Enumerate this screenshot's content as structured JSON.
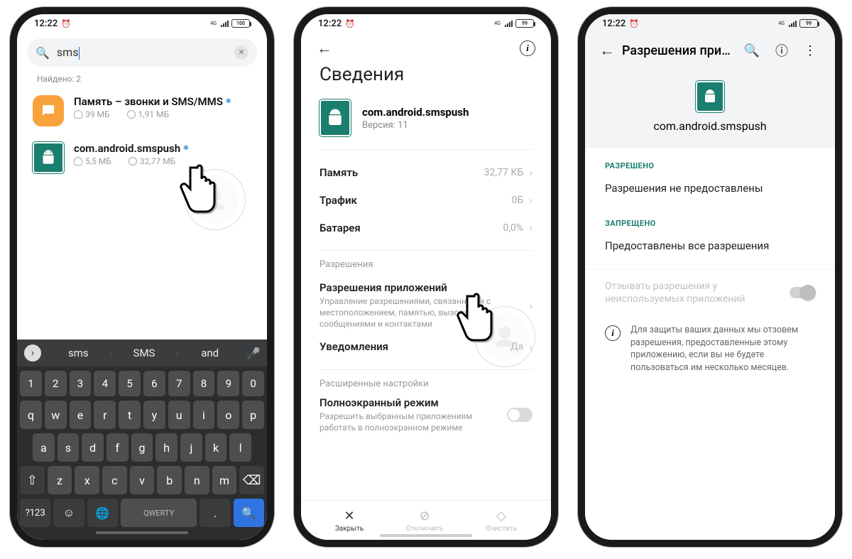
{
  "status": {
    "time": "12:22",
    "net": "4G",
    "battery1": "100",
    "battery23": "99"
  },
  "s1": {
    "search": "sms",
    "found": "Найдено: 2",
    "apps": [
      {
        "name": "Память – звонки и SMS/MMS",
        "mem": "39 МБ",
        "data": "1,91 МБ"
      },
      {
        "name": "com.android.smspush",
        "mem": "5,5 МБ",
        "data": "32,77 МБ"
      }
    ],
    "suggest": [
      "sms",
      "SMS",
      "and"
    ],
    "key_sym": "?123",
    "key_layout": "QWERTY"
  },
  "s2": {
    "title": "Сведения",
    "app": "com.android.smspush",
    "version": "Версия: 11",
    "rows": [
      {
        "k": "Память",
        "v": "32,77 КБ"
      },
      {
        "k": "Трафик",
        "v": "0Б"
      },
      {
        "k": "Батарея",
        "v": "0,0%"
      }
    ],
    "sect_perm": "Разрешения",
    "perm_title": "Разрешения приложений",
    "perm_sub": "Управление разрешениями, связанными с местоположением, памятью, вызовами, сообщениями и контактами",
    "notif": "Уведомления",
    "notif_v": "Да",
    "sect_adv": "Расширенные настройки",
    "fs_title": "Полноэкранный режим",
    "fs_sub": "Разрешить выбранным приложениям работать в полноэкранном режиме",
    "actions": {
      "close": "Закрыть",
      "disable": "Отключить",
      "clear": "Очистить"
    }
  },
  "s3": {
    "title": "Разрешения при…",
    "app": "com.android.smspush",
    "sect_allow": "РАЗРЕШЕНО",
    "allow_text": "Разрешения не предоставлены",
    "sect_deny": "ЗАПРЕЩЕНО",
    "deny_text": "Предоставлены все разрешения",
    "revoke": "Отзывать разрешения у неиспользуемых приложений",
    "info": "Для защиты ваших данных мы отзовем разрешения, предоставленные этому приложению, если вы не будете пользоваться им несколько месяцев."
  }
}
